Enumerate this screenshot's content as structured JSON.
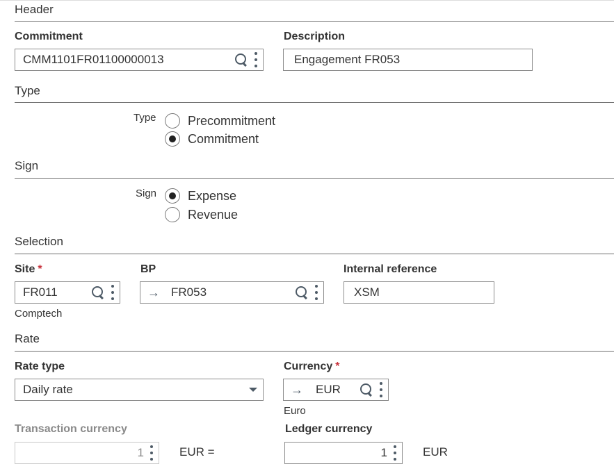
{
  "sections": {
    "header": "Header",
    "type": "Type",
    "sign": "Sign",
    "selection": "Selection",
    "rate": "Rate"
  },
  "commitment": {
    "label": "Commitment",
    "value": "CMM1101FR01100000013"
  },
  "description": {
    "label": "Description",
    "value": "Engagement FR053"
  },
  "type_group": {
    "label": "Type",
    "options": [
      "Precommitment",
      "Commitment"
    ],
    "selected": "Commitment"
  },
  "sign_group": {
    "label": "Sign",
    "options": [
      "Expense",
      "Revenue"
    ],
    "selected": "Expense"
  },
  "site": {
    "label": "Site",
    "required_mark": "*",
    "value": "FR011",
    "sub": "Comptech"
  },
  "bp": {
    "label": "BP",
    "arrow": "→",
    "value": "FR053"
  },
  "internal_reference": {
    "label": "Internal reference",
    "value": "XSM"
  },
  "rate_type": {
    "label": "Rate type",
    "value": "Daily rate"
  },
  "currency": {
    "label": "Currency",
    "required_mark": "*",
    "arrow": "→",
    "value": "EUR",
    "sub": "Euro"
  },
  "transaction_currency": {
    "label": "Transaction currency",
    "value": "1",
    "unit": "EUR ="
  },
  "ledger_currency": {
    "label": "Ledger currency",
    "value": "1",
    "unit": "EUR"
  }
}
